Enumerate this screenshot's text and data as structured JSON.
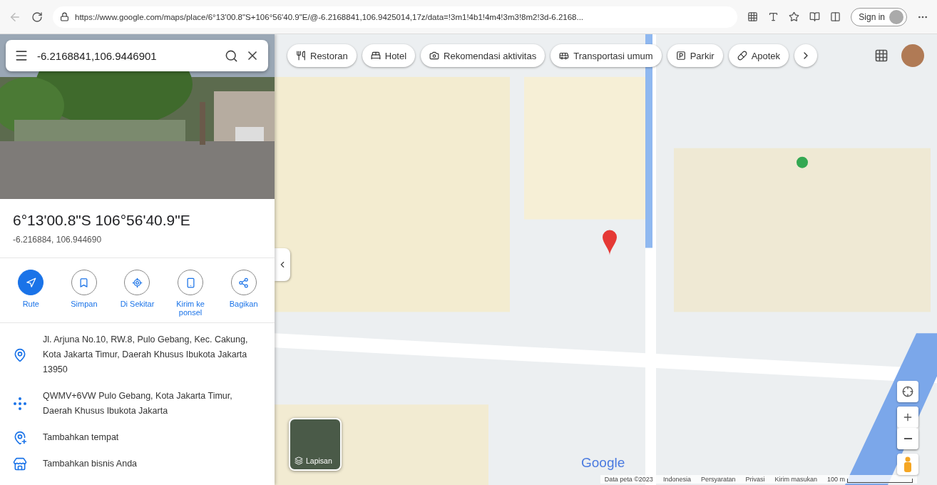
{
  "browser": {
    "url": "https://www.google.com/maps/place/6°13'00.8\"S+106°56'40.9\"E/@-6.2168841,106.9425014,17z/data=!3m1!4b1!4m4!3m3!8m2!3d-6.2168...",
    "sign_in": "Sign in"
  },
  "search": {
    "value": "-6.2168841,106.9446901"
  },
  "place": {
    "title": "6°13'00.8\"S 106°56'40.9\"E",
    "coords": "-6.216884, 106.944690"
  },
  "actions": [
    {
      "label": "Rute",
      "kind": "directions"
    },
    {
      "label": "Simpan",
      "kind": "save"
    },
    {
      "label": "Di Sekitar",
      "kind": "nearby"
    },
    {
      "label": "Kirim ke ponsel",
      "kind": "phone"
    },
    {
      "label": "Bagikan",
      "kind": "share"
    }
  ],
  "details": [
    {
      "kind": "address",
      "text": "Jl. Arjuna No.10, RW.8, Pulo Gebang, Kec. Cakung, Kota Jakarta Timur, Daerah Khusus Ibukota Jakarta 13950"
    },
    {
      "kind": "pluscode",
      "text": "QWMV+6VW Pulo Gebang, Kota Jakarta Timur, Daerah Khusus Ibukota Jakarta"
    },
    {
      "kind": "add-place",
      "text": "Tambahkan tempat"
    },
    {
      "kind": "add-business",
      "text": "Tambahkan bisnis Anda"
    }
  ],
  "chips": [
    {
      "label": "Restoran",
      "kind": "restaurant"
    },
    {
      "label": "Hotel",
      "kind": "hotel"
    },
    {
      "label": "Rekomendasi aktivitas",
      "kind": "camera"
    },
    {
      "label": "Transportasi umum",
      "kind": "transit"
    },
    {
      "label": "Parkir",
      "kind": "parking"
    },
    {
      "label": "Apotek",
      "kind": "pharmacy"
    }
  ],
  "layers": {
    "label": "Lapisan"
  },
  "logo": "Google",
  "footer": [
    "Data peta ©2023",
    "Indonesia",
    "Persyaratan",
    "Privasi",
    "Kirim masukan"
  ],
  "scale": "100 m"
}
